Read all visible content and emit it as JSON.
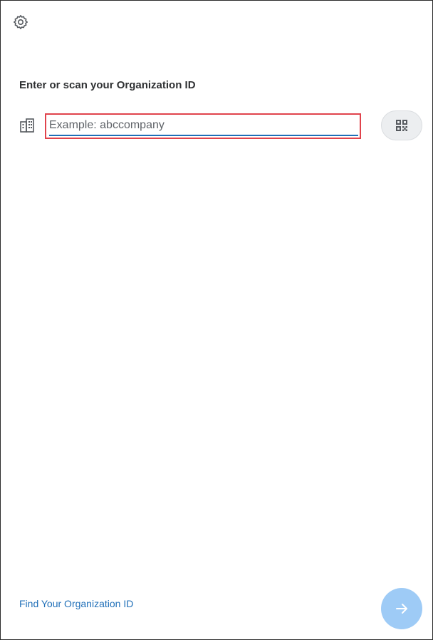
{
  "header": {
    "settings_icon": "gear-icon"
  },
  "main": {
    "prompt": "Enter or scan your Organization ID",
    "org_field": {
      "icon": "building-icon",
      "placeholder": "Example: abccompany",
      "value": ""
    },
    "scan_button_icon": "qr-code-icon"
  },
  "footer": {
    "find_link": "Find Your Organization ID",
    "next_icon": "arrow-right-icon"
  },
  "colors": {
    "accent": "#1f6fb8",
    "highlight_border": "#e0434c",
    "next_button": "#9ecbf6"
  }
}
